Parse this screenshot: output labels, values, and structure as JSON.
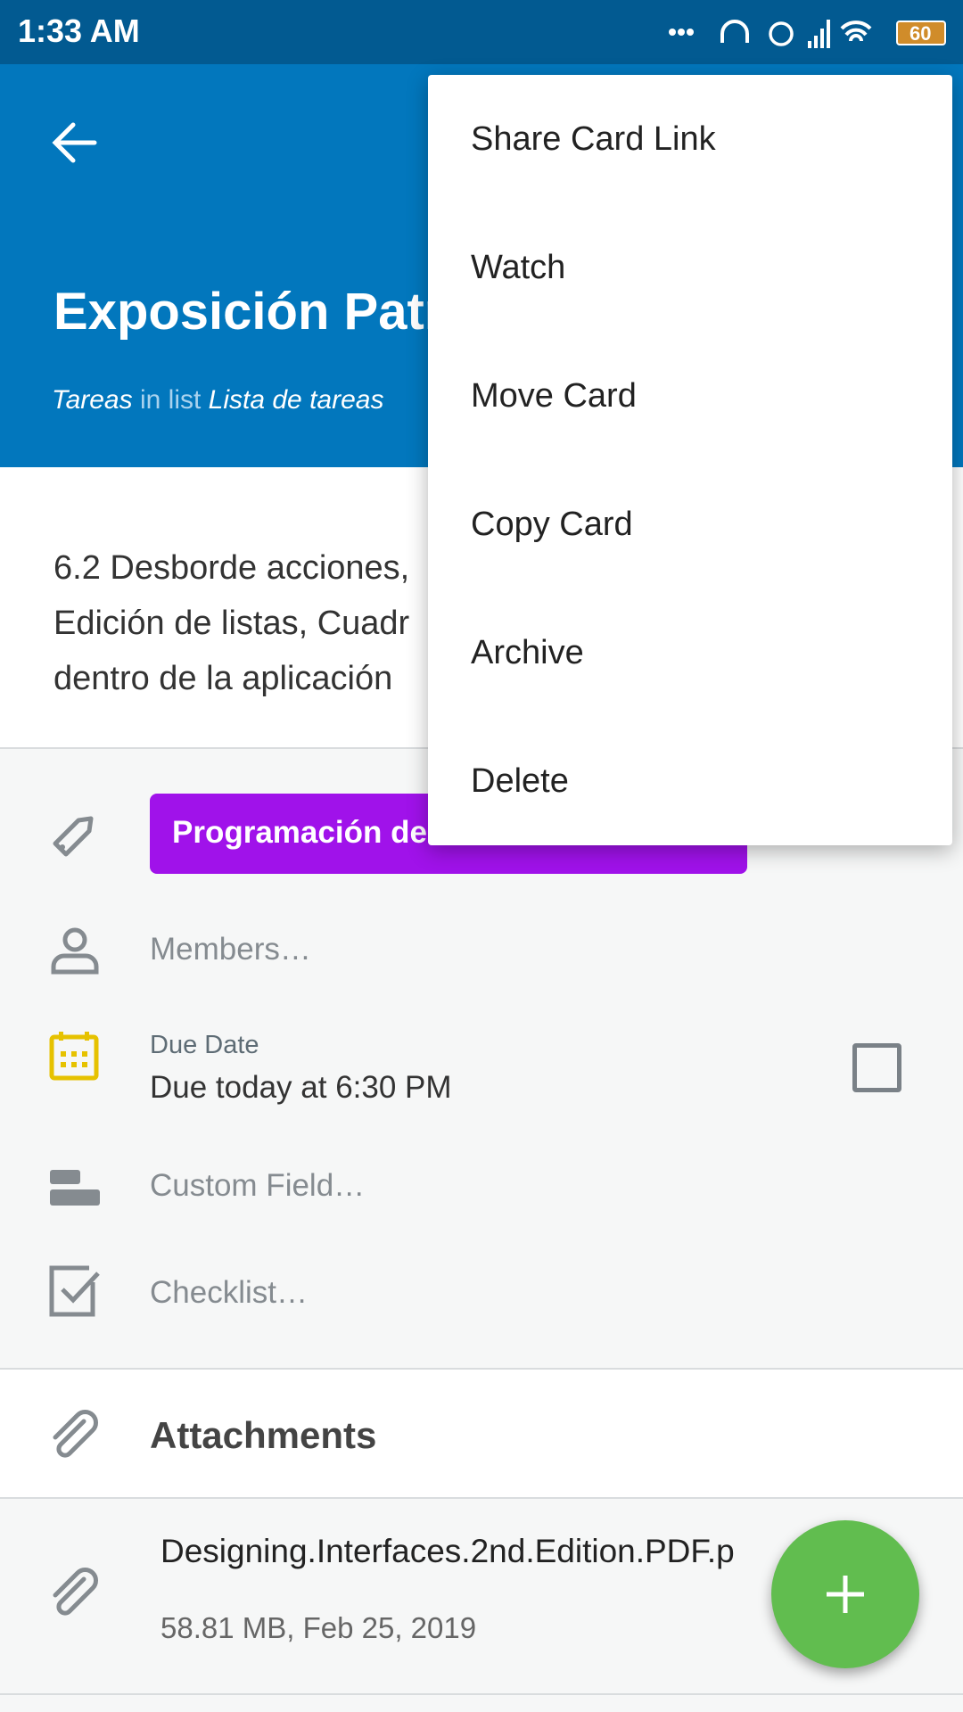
{
  "status_bar": {
    "time": "1:33 AM",
    "battery": "60",
    "icons": [
      "more-dots-icon",
      "headset-icon",
      "alarm-icon",
      "signal-icon",
      "wifi-icon",
      "battery-icon"
    ]
  },
  "header": {
    "title": "Exposición Patr",
    "board": "Tareas",
    "in_list": "in list",
    "list": "Lista de tareas",
    "bg": "#0277bd"
  },
  "description": {
    "lines": [
      "6.2 Desborde acciones,",
      "Edición de listas, Cuadr",
      "dentro de la aplicación"
    ]
  },
  "details": {
    "label": "Programación de",
    "label_color": "#a012ea",
    "members_placeholder": "Members…",
    "due_label": "Due Date",
    "due_value": "Due today at 6:30 PM",
    "due_complete": false,
    "custom_field_placeholder": "Custom Field…",
    "checklist_placeholder": "Checklist…"
  },
  "attachments": {
    "title": "Attachments",
    "items": [
      {
        "name": "Designing.Interfaces.2nd.Edition.PDF.p",
        "meta": "58.81 MB, Feb 25, 2019"
      }
    ]
  },
  "menu": {
    "items": [
      "Share Card Link",
      "Watch",
      "Move Card",
      "Copy Card",
      "Archive",
      "Delete"
    ]
  },
  "fab": {
    "icon": "plus-icon",
    "color": "#61bd4f"
  }
}
